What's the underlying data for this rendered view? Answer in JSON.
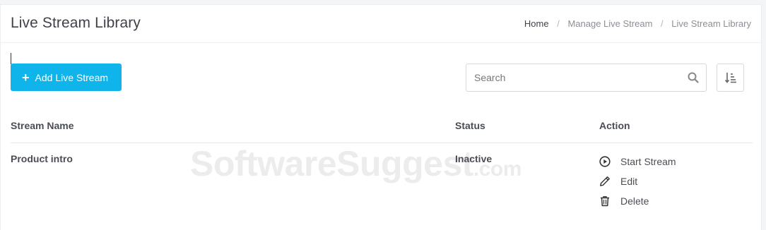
{
  "header": {
    "title": "Live Stream Library",
    "breadcrumb": [
      "Home",
      "Manage Live Stream",
      "Live Stream Library"
    ]
  },
  "toolbar": {
    "add_label": "Add Live Stream",
    "search_placeholder": "Search"
  },
  "table": {
    "columns": [
      "Stream Name",
      "Status",
      "Action"
    ],
    "rows": [
      {
        "name": "Product intro",
        "status": "Inactive",
        "actions": [
          "Start Stream",
          "Edit",
          "Delete"
        ]
      }
    ]
  },
  "watermark": {
    "main": "SoftwareSuggest",
    "suffix": ".com"
  },
  "colors": {
    "accent": "#0fb4ea"
  }
}
